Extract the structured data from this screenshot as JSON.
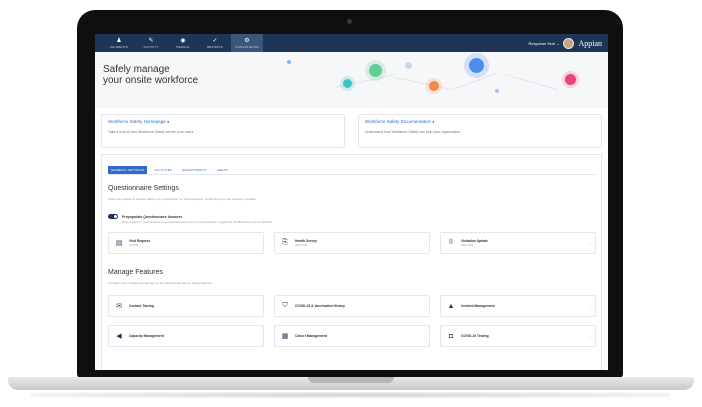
{
  "nav": {
    "tabs": [
      {
        "label": "INCIDENTS",
        "icon": "person-icon",
        "glyph": "♟"
      },
      {
        "label": "ACTIVITY",
        "icon": "chat-icon",
        "glyph": "✎"
      },
      {
        "label": "PEOPLE",
        "icon": "globe-icon",
        "glyph": "◉"
      },
      {
        "label": "REPORTS",
        "icon": "check-icon",
        "glyph": "✓"
      },
      {
        "label": "CONSOLIDATE",
        "icon": "gear-icon",
        "glyph": "⚙"
      }
    ],
    "active_index": 4,
    "site_name": "Response Hub ⌄",
    "logo": "Appian"
  },
  "hero": {
    "title_line1": "Safely manage",
    "title_line2": "your onsite workforce"
  },
  "links": [
    {
      "title": "Workforce Safety Homepage",
      "desc": "Take a look at how Workforce Safety serves your users"
    },
    {
      "title": "Workforce Safety Documentation",
      "desc": "Understand how Workforce Safety can help your organization"
    }
  ],
  "tabs": [
    "GENERAL SETTINGS",
    "FACILITIES",
    "DEPARTMENTS",
    "AREAS"
  ],
  "questionnaire": {
    "title": "Questionnaire Settings",
    "subtitle": "Select the questions needed within your organization for Start Requests, Health Surveys and Visitation Updates",
    "toggle_label": "Prepopulate Questionnaire Answers",
    "toggle_sub": "When toggled on, questionnaires are prepopulated with a user's previous answers. If toggled off, all affirmations must be submitted.",
    "cards": [
      {
        "title": "Visit Request",
        "sub": "ACTIVE",
        "icon": "document-icon",
        "glyph": "▤"
      },
      {
        "title": "Health Survey",
        "sub": "INACTIVE",
        "icon": "clipboard-icon",
        "glyph": "⎘"
      },
      {
        "title": "Visitation Update",
        "sub": "INACTIVE",
        "icon": "bed-icon",
        "glyph": "⌷"
      }
    ]
  },
  "features": {
    "title": "Manage Features",
    "subtitle": "Configure and manage the settings for the following Workforce Safety features",
    "cards": [
      {
        "title": "Contact Tracing",
        "icon": "chat-bubbles-icon",
        "glyph": "✉"
      },
      {
        "title": "COVID-19 & Vaccination History",
        "icon": "shield-icon",
        "glyph": "⛉"
      },
      {
        "title": "Incident Management",
        "icon": "warning-icon",
        "glyph": "▲"
      },
      {
        "title": "Capacity Management",
        "icon": "megaphone-icon",
        "glyph": "◀"
      },
      {
        "title": "Cohort Management",
        "icon": "grid-icon",
        "glyph": "▦"
      },
      {
        "title": "COVID-19 Testing",
        "icon": "test-kit-icon",
        "glyph": "◘"
      }
    ]
  },
  "colors": {
    "nav": "#1f3557",
    "accent": "#2f6dc4",
    "bubble_green": "#5fcf96",
    "bubble_teal": "#40c2c4",
    "bubble_orange": "#f08a4b",
    "bubble_blue": "#4c8ef0",
    "bubble_pink": "#e8457a"
  }
}
